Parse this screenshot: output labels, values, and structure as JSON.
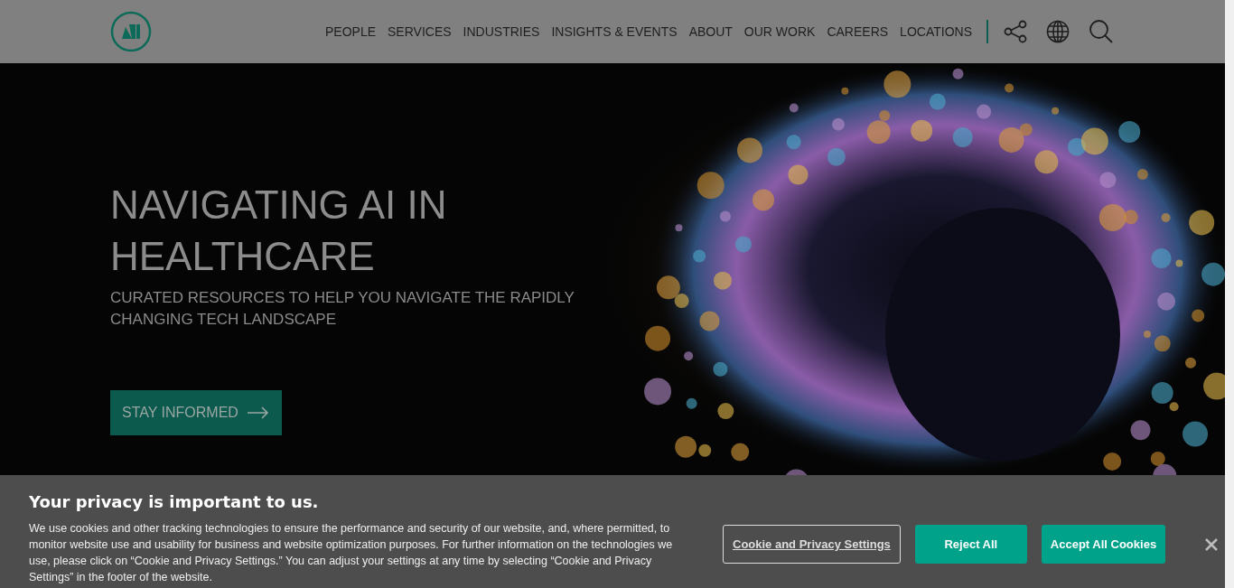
{
  "header": {
    "nav": [
      {
        "label": "PEOPLE"
      },
      {
        "label": "SERVICES"
      },
      {
        "label": "INDUSTRIES"
      },
      {
        "label": "INSIGHTS & EVENTS"
      },
      {
        "label": "ABOUT"
      },
      {
        "label": "OUR WORK"
      },
      {
        "label": "CAREERS"
      },
      {
        "label": "LOCATIONS"
      }
    ]
  },
  "hero": {
    "title": "NAVIGATING AI IN HEALTHCARE",
    "subtitle": "CURATED RESOURCES TO HELP YOU NAVIGATE THE RAPIDLY CHANGING TECH LANDSCAPE",
    "button": "STAY INFORMED"
  },
  "cookie_banner": {
    "title": "Your privacy is important to us.",
    "text": "We use cookies and other tracking technologies to ensure the performance and security of our website, and, where permitted, to monitor website use and usability for business and website optimization purposes. For further information on the technologies we use, please click on “Cookie and Privacy Settings.” You can adjust your settings at any time by selecting “Cookie and Privacy Settings” in the footer of the website.",
    "buttons": [
      {
        "label": "Cookie and Privacy Settings",
        "kind": "link"
      },
      {
        "label": "Reject All",
        "kind": "primary"
      },
      {
        "label": "Accept All Cookies",
        "kind": "primary"
      }
    ]
  }
}
